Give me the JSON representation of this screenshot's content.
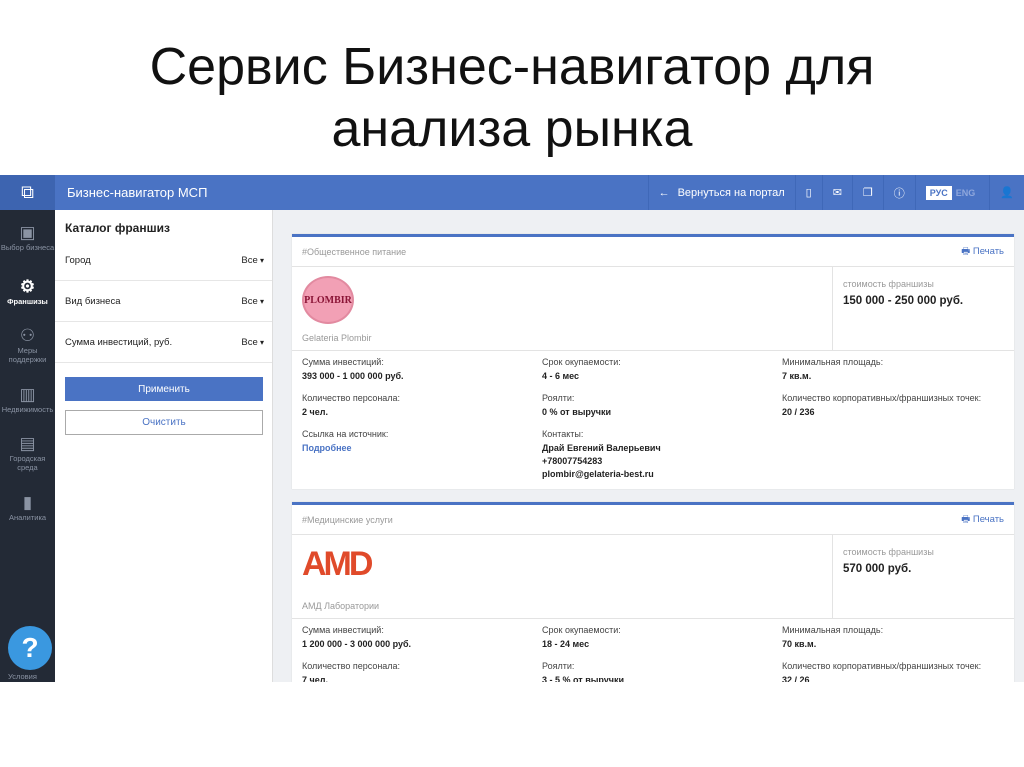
{
  "slide_title": [
    "Сервис Бизнес-навигатор для",
    "анализа рынка"
  ],
  "header": {
    "app_name": "Бизнес-навигатор МСП",
    "back": "Вернуться на портал",
    "lang_ru": "РУС",
    "lang_en": "ENG"
  },
  "sidebar": {
    "items": [
      {
        "label": "Выбор бизнеса",
        "icon": "briefcase-icon"
      },
      {
        "label": "Франшизы",
        "icon": "gear-icon"
      },
      {
        "label": "Меры поддержки",
        "icon": "people-icon"
      },
      {
        "label": "Недвижимость",
        "icon": "building-icon"
      },
      {
        "label": "Городская среда",
        "icon": "city-icon"
      },
      {
        "label": "Аналитика",
        "icon": "chart-icon"
      }
    ],
    "help_label": "Условия"
  },
  "filters": {
    "title": "Каталог франшиз",
    "rows": [
      {
        "label": "Город",
        "value": "Все"
      },
      {
        "label": "Вид бизнеса",
        "value": "Все"
      },
      {
        "label": "Сумма инвестиций, руб.",
        "value": "Все"
      }
    ],
    "apply": "Применить",
    "clear": "Очистить"
  },
  "cards": [
    {
      "tag": "#Общественное питание",
      "print": "Печать",
      "logo_text": "PLOMBIR",
      "name": "Gelateria Plombir",
      "cost_label": "стоимость франшизы",
      "cost": "150 000 - 250 000 руб.",
      "fields": [
        {
          "label": "Сумма инвестиций:",
          "value": "393 000 - 1 000 000 руб."
        },
        {
          "label": "Срок окупаемости:",
          "value": "4 - 6 мес"
        },
        {
          "label": "Минимальная площадь:",
          "value": "7 кв.м."
        },
        {
          "label": "Количество персонала:",
          "value": "2 чел."
        },
        {
          "label": "Роялти:",
          "value": "0 % от выручки"
        },
        {
          "label": "Количество корпоративных/франшизных точек:",
          "value": "20 / 236"
        },
        {
          "label": "Ссылка на источник:",
          "value": "Подробнее"
        },
        {
          "label": "Контакты:",
          "value": "Драй Евгений Валерьевич",
          "phone": "+78007754283",
          "email": "plombir@gelateria-best.ru"
        }
      ]
    },
    {
      "tag": "#Медицинские услуги",
      "print": "Печать",
      "logo_text": "AMD",
      "name": "АМД Лаборатории",
      "cost_label": "стоимость франшизы",
      "cost": "570 000 руб.",
      "fields": [
        {
          "label": "Сумма инвестиций:",
          "value": "1 200 000 - 3 000 000 руб."
        },
        {
          "label": "Срок окупаемости:",
          "value": "18 - 24 мес"
        },
        {
          "label": "Минимальная площадь:",
          "value": "70 кв.м."
        },
        {
          "label": "Количество персонала:",
          "value": "7 чел."
        },
        {
          "label": "Роялти:",
          "value": "3 - 5 % от выручки"
        },
        {
          "label": "Количество корпоративных/франшизных точек:",
          "value": "32 / 26"
        }
      ]
    }
  ]
}
